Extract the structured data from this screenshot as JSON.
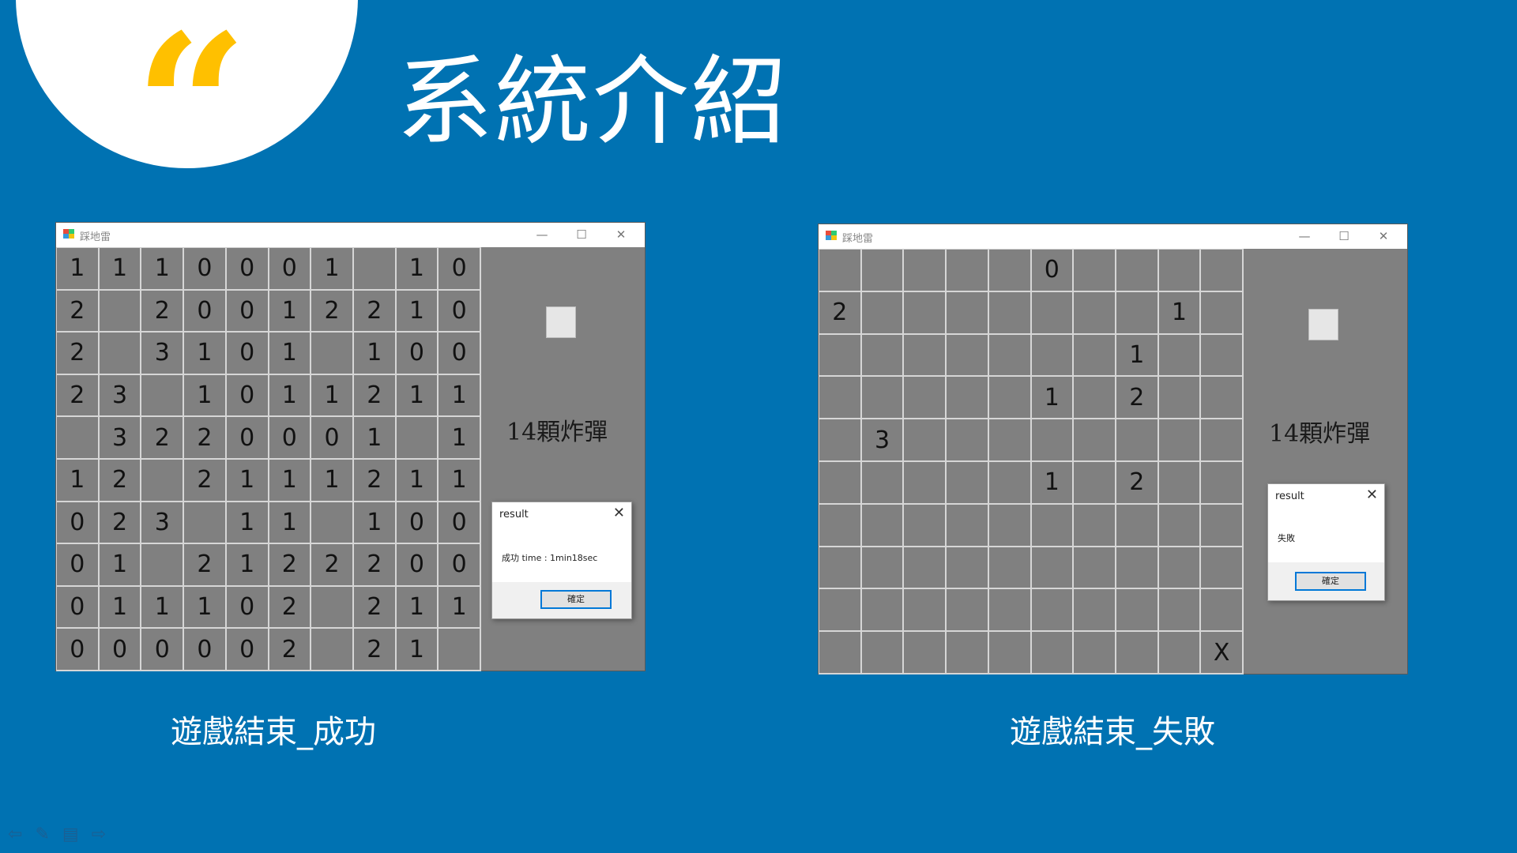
{
  "slide": {
    "title": "系統介紹",
    "quote_glyph": "“",
    "accent_color": "#ffc000",
    "background_color": "#0072b2"
  },
  "left_window": {
    "app_title": "踩地雷",
    "bomb_label": "14顆炸彈",
    "board": [
      [
        "1",
        "1",
        "1",
        "0",
        "0",
        "0",
        "1",
        "",
        "1",
        "0"
      ],
      [
        "2",
        "",
        "2",
        "0",
        "0",
        "1",
        "2",
        "2",
        "1",
        "0"
      ],
      [
        "2",
        "",
        "3",
        "1",
        "0",
        "1",
        "",
        "1",
        "0",
        "0"
      ],
      [
        "2",
        "3",
        "",
        "1",
        "0",
        "1",
        "1",
        "2",
        "1",
        "1"
      ],
      [
        "",
        "3",
        "2",
        "2",
        "0",
        "0",
        "0",
        "1",
        "",
        "1"
      ],
      [
        "1",
        "2",
        "",
        "2",
        "1",
        "1",
        "1",
        "2",
        "1",
        "1"
      ],
      [
        "0",
        "2",
        "3",
        "",
        "1",
        "1",
        "",
        "1",
        "0",
        "0"
      ],
      [
        "0",
        "1",
        "",
        "2",
        "1",
        "2",
        "2",
        "2",
        "0",
        "0"
      ],
      [
        "0",
        "1",
        "1",
        "1",
        "0",
        "2",
        "",
        "2",
        "1",
        "1"
      ],
      [
        "0",
        "0",
        "0",
        "0",
        "0",
        "2",
        "",
        "2",
        "1",
        ""
      ]
    ],
    "dialog": {
      "title": "result",
      "message": "成功  time : 1min18sec",
      "ok_label": "確定"
    },
    "caption": "遊戲結束_成功"
  },
  "right_window": {
    "app_title": "踩地雷",
    "bomb_label": "14顆炸彈",
    "board": [
      [
        "",
        "",
        "",
        "",
        "",
        "0",
        "",
        "",
        "",
        ""
      ],
      [
        "2",
        "",
        "",
        "",
        "",
        "",
        "",
        "",
        "1",
        ""
      ],
      [
        "",
        "",
        "",
        "",
        "",
        "",
        "",
        "1",
        "",
        ""
      ],
      [
        "",
        "",
        "",
        "",
        "",
        "1",
        "",
        "2",
        "",
        ""
      ],
      [
        "",
        "3",
        "",
        "",
        "",
        "",
        "",
        "",
        "",
        ""
      ],
      [
        "",
        "",
        "",
        "",
        "",
        "1",
        "",
        "2",
        "",
        ""
      ],
      [
        "",
        "",
        "",
        "",
        "",
        "",
        "",
        "",
        "",
        ""
      ],
      [
        "",
        "",
        "",
        "",
        "",
        "",
        "",
        "",
        "",
        ""
      ],
      [
        "",
        "",
        "",
        "",
        "",
        "",
        "",
        "",
        "",
        ""
      ],
      [
        "",
        "",
        "",
        "",
        "",
        "",
        "",
        "",
        "",
        "X"
      ]
    ],
    "dialog": {
      "title": "result",
      "message": "失敗",
      "ok_label": "確定"
    },
    "caption": "遊戲結束_失敗"
  },
  "window_controls": {
    "minimize": "—",
    "maximize": "☐",
    "close": "✕"
  }
}
